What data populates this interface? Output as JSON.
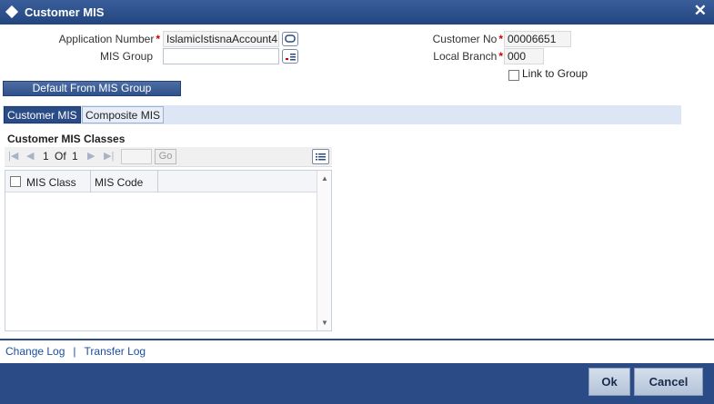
{
  "window": {
    "title": "Customer MIS",
    "close_glyph": "✕"
  },
  "form": {
    "application_number_label": "Application Number",
    "application_number_value": "IslamicIstisnaAccount4",
    "mis_group_label": "MIS Group",
    "mis_group_value": "",
    "customer_no_label": "Customer No",
    "customer_no_value": "00006651",
    "local_branch_label": "Local Branch",
    "local_branch_value": "000",
    "link_to_group_label": "Link to Group",
    "required_mark": "*"
  },
  "default_button_label": "Default From MIS Group",
  "tabs": [
    {
      "label": "Customer MIS",
      "active": true
    },
    {
      "label": "Composite MIS",
      "active": false
    }
  ],
  "section_title": "Customer MIS Classes",
  "pager": {
    "current": "1",
    "of_label": "Of",
    "total": "1",
    "go_label": "Go"
  },
  "grid": {
    "columns": [
      "MIS Class",
      "MIS Code"
    ]
  },
  "links": {
    "change_log": "Change Log",
    "separator": "|",
    "transfer_log": "Transfer Log"
  },
  "buttons": {
    "ok": "Ok",
    "cancel": "Cancel"
  },
  "colors": {
    "header": "#2a4b86",
    "required": "#cc0000",
    "link": "#1b4ea3"
  },
  "icons": [
    "diamond-icon",
    "close-icon",
    "lov-icon",
    "first-page-icon",
    "prev-page-icon",
    "next-page-icon",
    "last-page-icon",
    "grid-options-icon",
    "scroll-up-icon",
    "scroll-down-icon"
  ]
}
